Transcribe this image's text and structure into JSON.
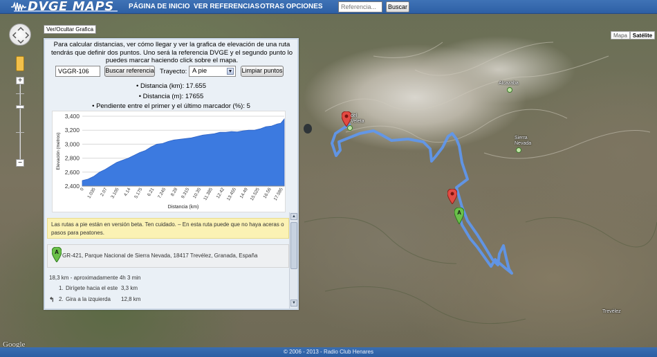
{
  "header": {
    "logo_text": "DVGE MAPS",
    "nav": [
      {
        "label": "PÁGINA DE INICIO"
      },
      {
        "label": "VER REFERENCIAS"
      },
      {
        "label": "OTRAS OPCIONES"
      }
    ],
    "search_placeholder": "Referencia...",
    "search_button": "Buscar"
  },
  "map": {
    "type_buttons": [
      "Mapa",
      "Satélite"
    ],
    "active_type": "Satélite",
    "zoom_in": "+",
    "zoom_out": "−",
    "toggle_chart_label": "Ver/Ocultar Grafica",
    "places": [
      {
        "label": "del\nVeleta"
      },
      {
        "label": "Alcazaba"
      },
      {
        "label": "Sierra\nNevada"
      },
      {
        "label": "Trevélez"
      }
    ],
    "google": "Google"
  },
  "panel": {
    "intro": "Para calcular distancias, ver cómo llegar y ver la grafica de elevación de una ruta tendrás que definir dos puntos. Uno será la referencia DVGE y el segundo punto lo puedes marcar haciendo click sobre el mapa.",
    "reference_value": "VGGR-106",
    "search_reference_button": "Buscar referencia",
    "trayecto_label": "Trayecto:",
    "trayecto_selected": "A pie",
    "clear_points_button": "Limpiar puntos",
    "stats": [
      "Distancia (km): 17.655",
      "Distancia (m): 17655",
      "Pendiente entre el primer y el último marcador (%): 5"
    ],
    "warning": "Las rutas a pie están en versión beta. Ten cuidado. – En esta ruta puede que no haya aceras o pasos para peatones.",
    "address_marker": "A",
    "address": "GR-421, Parque Nacional de Sierra Nevada, 18417 Trevélez, Granada, España",
    "summary": "18,3 km - aproximadamente 4h 3 min",
    "steps": [
      {
        "num": "1.",
        "text": "Dirígete hacia el este",
        "dist": "3,3 km"
      },
      {
        "num": "2.",
        "text": "Gira a la izquierda",
        "dist": "12,8 km"
      }
    ]
  },
  "footer": "© 2006 - 2013 - Radio Club Henares",
  "chart_data": {
    "type": "area",
    "xlabel": "Distancia (km)",
    "ylabel": "Elevación (metros)",
    "ylim": [
      2400,
      3400
    ],
    "yticks": [
      2400,
      2600,
      2800,
      3000,
      3200,
      3400
    ],
    "ytick_labels": [
      "2,400",
      "2,600",
      "2,800",
      "3,000",
      "3,200",
      "3,400"
    ],
    "xtick_labels": [
      "0",
      "1.035",
      "2.07",
      "3.105",
      "4.14",
      "5.175",
      "6.21",
      "7.245",
      "8.28",
      "9.315",
      "10.35",
      "11.385",
      "12.42",
      "13.455",
      "14.49",
      "15.525",
      "16.56",
      "17.595"
    ],
    "x": [
      0,
      0.5,
      1.0,
      1.5,
      2.0,
      2.5,
      3.0,
      3.5,
      4.0,
      4.5,
      5.0,
      5.5,
      6.0,
      6.5,
      7.0,
      7.5,
      8.0,
      8.5,
      9.0,
      9.5,
      10.0,
      10.5,
      11.0,
      11.5,
      12.0,
      12.5,
      13.0,
      13.5,
      14.0,
      14.5,
      15.0,
      15.5,
      16.0,
      16.5,
      17.0,
      17.3,
      17.6
    ],
    "y": [
      2480,
      2500,
      2540,
      2600,
      2640,
      2690,
      2740,
      2770,
      2800,
      2840,
      2880,
      2910,
      2960,
      3000,
      3010,
      3040,
      3060,
      3070,
      3080,
      3090,
      3110,
      3130,
      3140,
      3150,
      3170,
      3170,
      3180,
      3175,
      3190,
      3200,
      3200,
      3220,
      3250,
      3260,
      3290,
      3300,
      3360
    ],
    "color": "#3c7ae0",
    "grid": true,
    "legend": "none"
  }
}
